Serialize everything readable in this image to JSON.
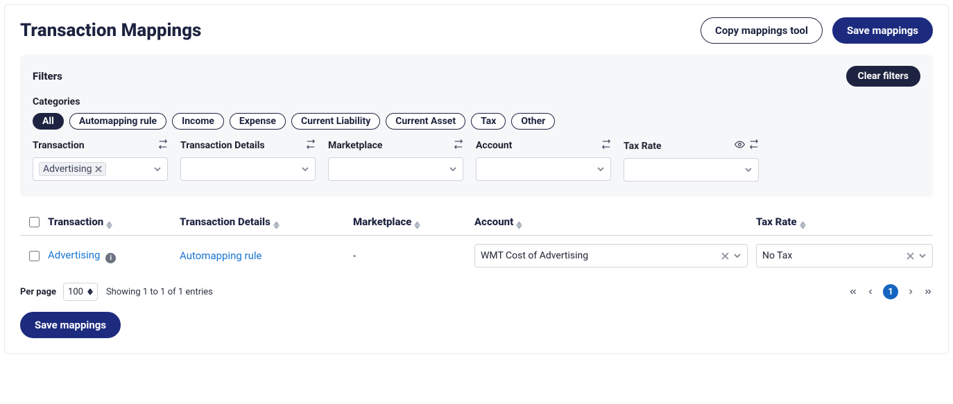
{
  "header": {
    "title": "Transaction Mappings",
    "copy_btn": "Copy mappings tool",
    "save_btn": "Save mappings"
  },
  "filters": {
    "section_label": "Filters",
    "clear_btn": "Clear filters",
    "categories_label": "Categories",
    "category_chips": [
      "All",
      "Automapping rule",
      "Income",
      "Expense",
      "Current Liability",
      "Current Asset",
      "Tax",
      "Other"
    ],
    "columns": {
      "transaction": {
        "label": "Transaction",
        "tag_value": "Advertising"
      },
      "transaction_details": {
        "label": "Transaction Details"
      },
      "marketplace": {
        "label": "Marketplace"
      },
      "account": {
        "label": "Account"
      },
      "tax_rate": {
        "label": "Tax Rate"
      }
    }
  },
  "table": {
    "headers": {
      "transaction": "Transaction",
      "transaction_details": "Transaction Details",
      "marketplace": "Marketplace",
      "account": "Account",
      "tax_rate": "Tax Rate"
    },
    "rows": [
      {
        "transaction": "Advertising",
        "transaction_details": "Automapping rule",
        "marketplace": "-",
        "account": "WMT Cost of Advertising",
        "tax_rate": "No Tax"
      }
    ]
  },
  "pagination": {
    "per_page_label": "Per page",
    "per_page_value": "100",
    "count_text": "Showing 1 to 1 of 1 entries",
    "current_page": "1"
  },
  "bottom_save": "Save mappings"
}
